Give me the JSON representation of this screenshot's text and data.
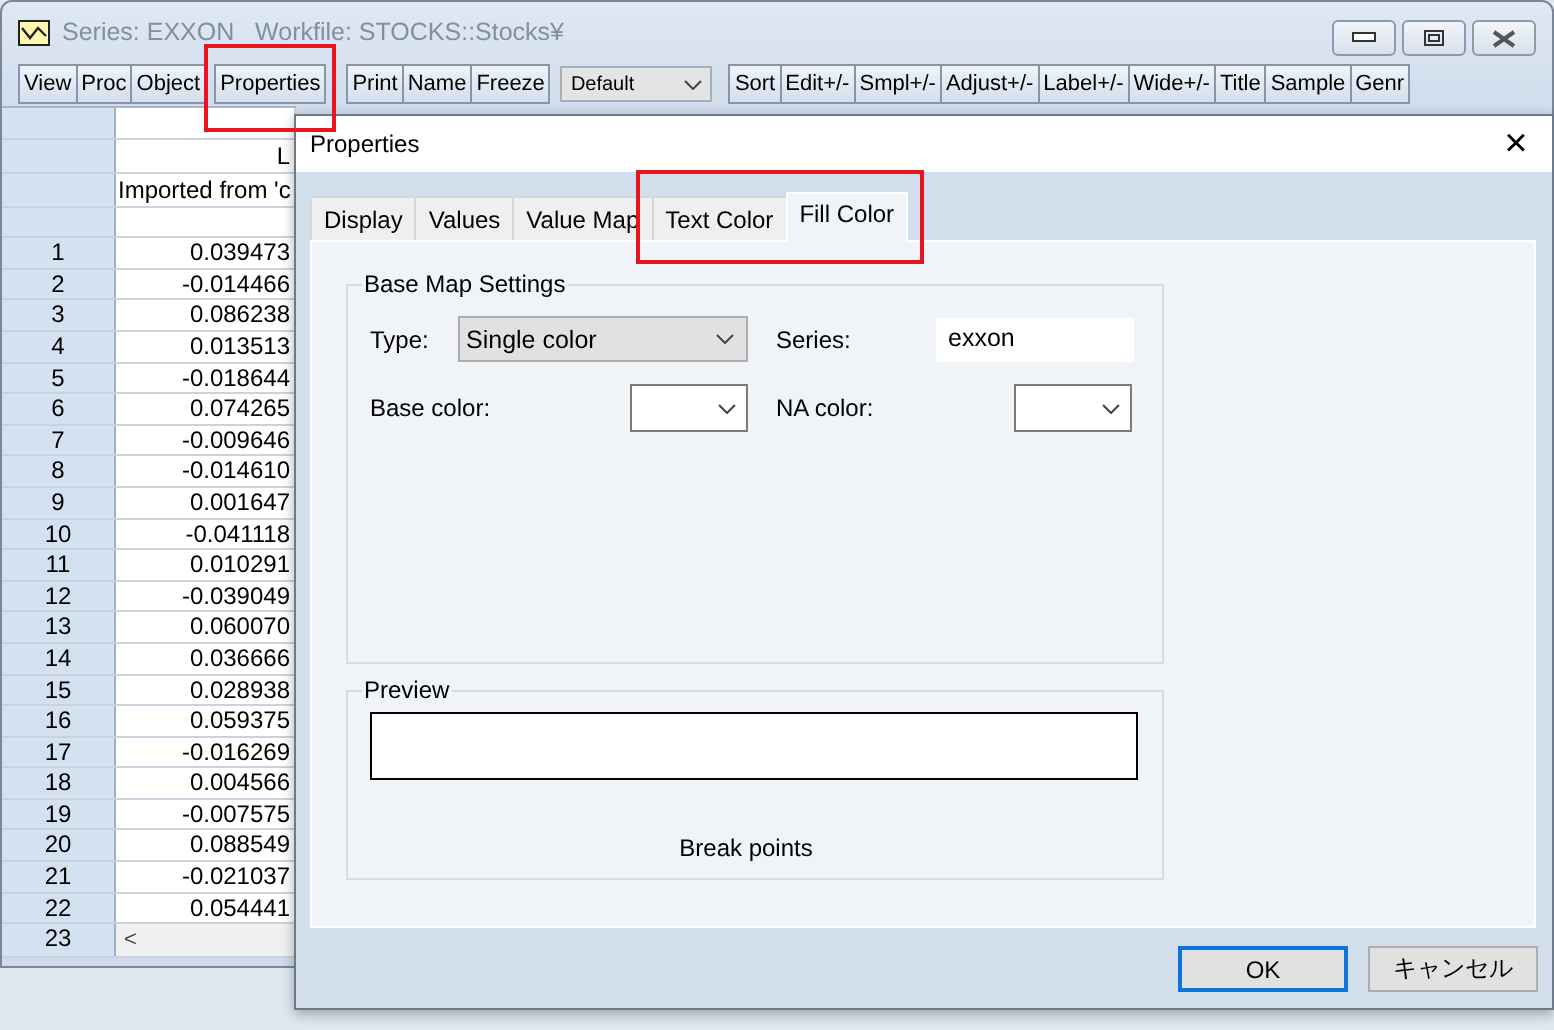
{
  "window": {
    "title": "Series: EXXON   Workfile: STOCKS::Stocks¥",
    "active": false
  },
  "toolbar": [
    {
      "kind": "buttons",
      "items": [
        {
          "label": "View",
          "highlighted": false
        },
        {
          "label": "Proc",
          "highlighted": false
        },
        {
          "label": "Object",
          "highlighted": false
        },
        {
          "label": "Properties",
          "highlighted": true
        }
      ]
    },
    {
      "kind": "buttons",
      "items": [
        {
          "label": "Print",
          "highlighted": false
        },
        {
          "label": "Name",
          "highlighted": false
        },
        {
          "label": "Freeze",
          "highlighted": false
        }
      ]
    },
    {
      "kind": "dropdown",
      "value": "Default"
    },
    {
      "kind": "buttons",
      "items": [
        {
          "label": "Sort",
          "highlighted": false
        },
        {
          "label": "Edit+/-",
          "highlighted": false
        },
        {
          "label": "Smpl+/-",
          "highlighted": false
        },
        {
          "label": "Adjust+/-",
          "highlighted": false
        },
        {
          "label": "Label+/-",
          "highlighted": false
        },
        {
          "label": "Wide+/-",
          "highlighted": false
        },
        {
          "label": "Title",
          "highlighted": false
        },
        {
          "label": "Sample",
          "highlighted": false
        },
        {
          "label": "Genr",
          "highlighted": false
        }
      ]
    }
  ],
  "sheet": {
    "column_header": "L",
    "description": "Imported from 'c",
    "rows": [
      {
        "number": "1",
        "value": "0.039473"
      },
      {
        "number": "2",
        "value": "-0.014466"
      },
      {
        "number": "3",
        "value": "0.086238"
      },
      {
        "number": "4",
        "value": "0.013513"
      },
      {
        "number": "5",
        "value": "-0.018644"
      },
      {
        "number": "6",
        "value": "0.074265"
      },
      {
        "number": "7",
        "value": "-0.009646"
      },
      {
        "number": "8",
        "value": "-0.014610"
      },
      {
        "number": "9",
        "value": "0.001647"
      },
      {
        "number": "10",
        "value": "-0.041118"
      },
      {
        "number": "11",
        "value": "0.010291"
      },
      {
        "number": "12",
        "value": "-0.039049"
      },
      {
        "number": "13",
        "value": "0.060070"
      },
      {
        "number": "14",
        "value": "0.036666"
      },
      {
        "number": "15",
        "value": "0.028938"
      },
      {
        "number": "16",
        "value": "0.059375"
      },
      {
        "number": "17",
        "value": "-0.016269"
      },
      {
        "number": "18",
        "value": "0.004566"
      },
      {
        "number": "19",
        "value": "-0.007575"
      },
      {
        "number": "20",
        "value": "0.088549"
      },
      {
        "number": "21",
        "value": "-0.021037"
      },
      {
        "number": "22",
        "value": "0.054441"
      },
      {
        "number": "23"
      }
    ],
    "scroll_left": "<"
  },
  "dialog": {
    "title": "Properties",
    "close": "×",
    "tabs": [
      {
        "label": "Display",
        "selected": false,
        "highlighted": false
      },
      {
        "label": "Values",
        "selected": false,
        "highlighted": false
      },
      {
        "label": "Value Map",
        "selected": false,
        "highlighted": false
      },
      {
        "label": "Text Color",
        "selected": false,
        "highlighted": true
      },
      {
        "label": "Fill Color",
        "selected": true,
        "highlighted": true
      }
    ],
    "base_map_settings": {
      "title": "Base Map Settings",
      "type_label": "Type:",
      "type_value": "Single color",
      "series_label": "Series:",
      "series_value": "exxon",
      "base_color_label": "Base color:",
      "na_color_label": "NA color:"
    },
    "preview": {
      "title": "Preview",
      "caption": "Break points"
    },
    "buttons": [
      {
        "label": "OK",
        "default": true
      },
      {
        "label": "キャンセル",
        "default": false
      }
    ]
  }
}
